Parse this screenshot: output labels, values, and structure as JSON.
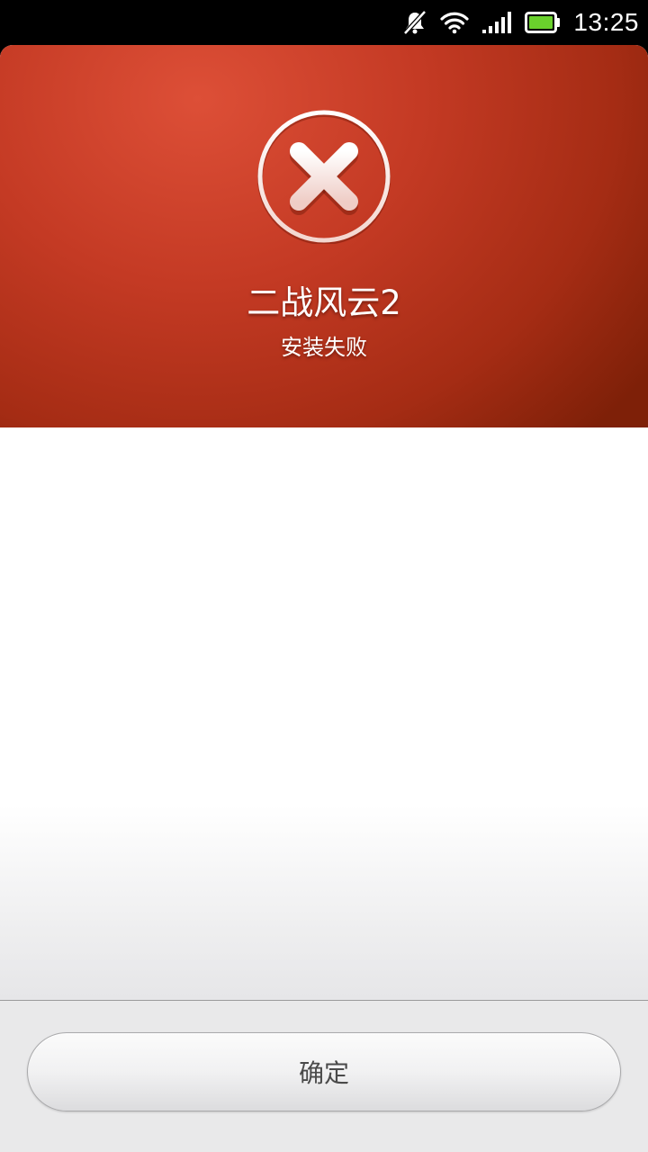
{
  "status_bar": {
    "time": "13:25",
    "icons": [
      "notifications-muted-icon",
      "wifi-icon",
      "signal-icon",
      "battery-icon"
    ],
    "battery_color": "#6ad12c"
  },
  "result": {
    "icon": "close-x-icon",
    "app_name": "二战风云2",
    "message": "安装失败",
    "header_color": "#c43a24"
  },
  "footer": {
    "confirm_label": "确定"
  }
}
